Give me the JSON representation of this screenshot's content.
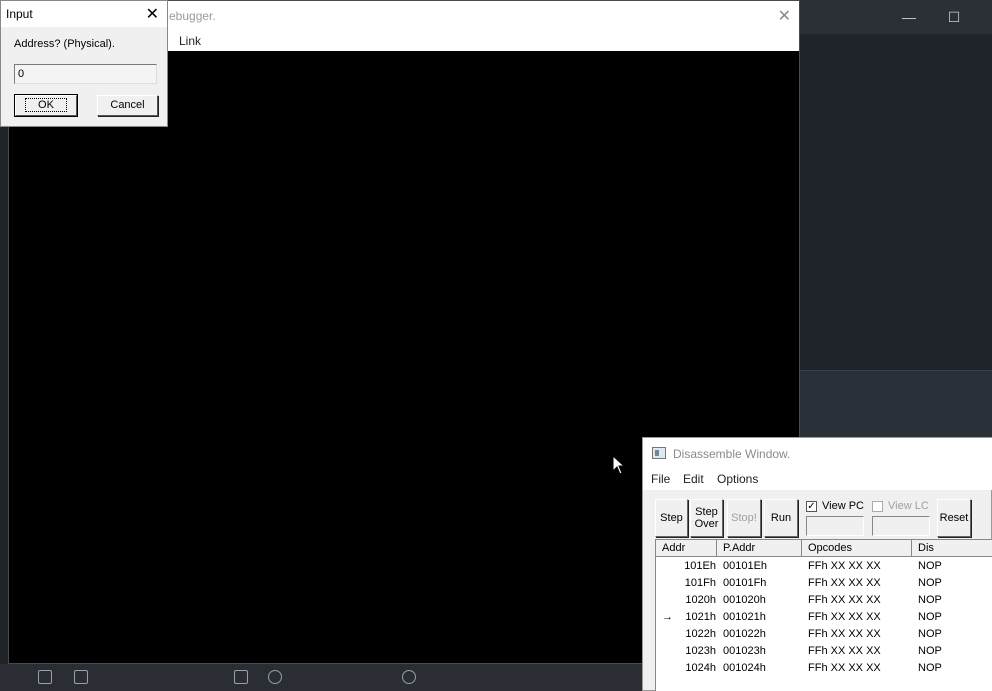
{
  "main_window": {
    "title": "ebugger.",
    "menu_link": "Link"
  },
  "input_dialog": {
    "title": "Input",
    "prompt": "Address? (Physical).",
    "value": "0",
    "ok_label": "OK",
    "cancel_label": "Cancel",
    "close_glyph": "✕"
  },
  "disassemble": {
    "title": "Disassemble Window.",
    "menu": {
      "file": "File",
      "edit": "Edit",
      "options": "Options"
    },
    "buttons": {
      "step": "Step",
      "step_over": "Step Over",
      "stop": "Stop!",
      "run": "Run",
      "reset": "Reset"
    },
    "view_pc_label": "View PC",
    "view_pc_checked": true,
    "view_lc_label": "View LC",
    "view_lc_checked": false,
    "columns": [
      "Addr",
      "P.Addr",
      "Opcodes",
      "Dis"
    ],
    "rows": [
      {
        "addr": "101Eh",
        "paddr": "00101Eh",
        "op": "FFh XX XX XX",
        "dis": "NOP",
        "current": false
      },
      {
        "addr": "101Fh",
        "paddr": "00101Fh",
        "op": "FFh XX XX XX",
        "dis": "NOP",
        "current": false
      },
      {
        "addr": "1020h",
        "paddr": "001020h",
        "op": "FFh XX XX XX",
        "dis": "NOP",
        "current": false
      },
      {
        "addr": "1021h",
        "paddr": "001021h",
        "op": "FFh XX XX XX",
        "dis": "NOP",
        "current": true
      },
      {
        "addr": "1022h",
        "paddr": "001022h",
        "op": "FFh XX XX XX",
        "dis": "NOP",
        "current": false
      },
      {
        "addr": "1023h",
        "paddr": "001023h",
        "op": "FFh XX XX XX",
        "dis": "NOP",
        "current": false
      },
      {
        "addr": "1024h",
        "paddr": "001024h",
        "op": "FFh XX XX XX",
        "dis": "NOP",
        "current": false
      }
    ]
  },
  "colors": {
    "debugger_background": "#000000",
    "dialog_face": "#f0f0f0",
    "desktop": "#1f232a"
  }
}
